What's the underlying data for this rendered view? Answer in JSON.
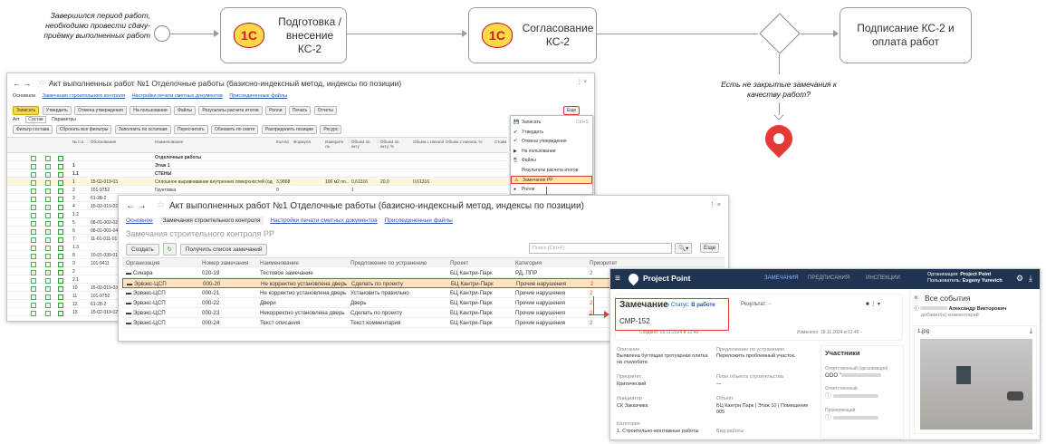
{
  "flow": {
    "start_note": "Завершился период работ, необходимо провести сдачу-приёмку выполненных работ",
    "logo_text": "1С",
    "stage1": "Подготовка / внесение КС-2",
    "stage2": "Согласование КС-2",
    "stage3": "Подписание КС-2 и оплата работ",
    "question": "Есть не закрытые замечания к качеству работ?"
  },
  "win1": {
    "title": "Акт выполненных работ №1 Отделочные работы (базисно-индексный метод, индексы по позиции)",
    "tabs": [
      "Основное",
      "Замечания строительного контроля",
      "Настройки печати сметных документов",
      "Присоединенные файлы"
    ],
    "toolbar": [
      "Записать",
      "Утвердить",
      "Отмена утверждения",
      "На пользовании",
      "Файлы",
      "Результаты расчета итогов",
      "Ролли",
      "Печать",
      "Отчеты"
    ],
    "more": "Еще",
    "subtabs": [
      "Акт",
      "Состав",
      "Параметры"
    ],
    "filters": [
      "Фильтр состава",
      "Сбросить все фильтры",
      "Заполнить по остаткам",
      "Пересчитать",
      "Обновить по смете",
      "Распределить позиции",
      "Ресурс"
    ],
    "columns": [
      "№ п.п.",
      "Обоснование",
      "Наименование",
      "Кол-во",
      "Формула",
      "Измерите ль",
      "Объем по акту",
      "Объем по акту, %",
      "Объем с начала",
      "Объем с начала, %",
      "Стоим"
    ],
    "rows": [
      {
        "n": "",
        "code": "",
        "name": "Отделочные работы",
        "q": "",
        "u": "",
        "a": "",
        "b": "",
        "c": ""
      },
      {
        "n": "1",
        "code": "",
        "name": "Этаж 1",
        "q": "",
        "u": "",
        "a": "",
        "b": "",
        "c": ""
      },
      {
        "n": "1.1",
        "code": "",
        "name": "СТЕНЫ",
        "q": "",
        "u": "",
        "a": "",
        "b": "",
        "c": ""
      },
      {
        "n": "1",
        "code": "15-02-019-03",
        "name": "Сплошное выравнивание внутренних поверхностей (одно...",
        "q": "3,9868",
        "u": "100 м2 по...",
        "a": "0,61316",
        "b": "20,0",
        "c": "0,61316"
      },
      {
        "n": "2",
        "code": "101-9752",
        "name": "Грунтовка",
        "q": "0",
        "u": "",
        "a": "1",
        "b": "",
        "c": ""
      },
      {
        "n": "3",
        "code": "61-28-2",
        "name": "Устройство основания под штукатурку из металлическ...",
        "q": "4,237",
        "u": "100 м2 по...",
        "a": "0,8474",
        "b": "20,0",
        "c": "0,8474"
      },
      {
        "n": "4",
        "code": "15-02-019-02",
        "name": "",
        "q": "",
        "u": "",
        "a": "",
        "b": "",
        "c": ""
      },
      {
        "n": "1.2",
        "code": "",
        "name": "",
        "q": "",
        "u": "",
        "a": "",
        "b": "",
        "c": ""
      },
      {
        "n": "5",
        "code": "08-01-002-02",
        "name": "",
        "q": "",
        "u": "",
        "a": "",
        "b": "",
        "c": ""
      },
      {
        "n": "6",
        "code": "08-01-001-04",
        "name": "",
        "q": "",
        "u": "",
        "a": "",
        "b": "",
        "c": ""
      },
      {
        "n": "7",
        "code": "11-01-011-01",
        "name": "",
        "q": "",
        "u": "",
        "a": "",
        "b": "",
        "c": ""
      },
      {
        "n": "1.3",
        "code": "",
        "name": "",
        "q": "",
        "u": "",
        "a": "",
        "b": "",
        "c": ""
      },
      {
        "n": "8",
        "code": "10-01-039-01",
        "name": "",
        "q": "",
        "u": "",
        "a": "",
        "b": "",
        "c": ""
      },
      {
        "n": "9",
        "code": "101-9411",
        "name": "",
        "q": "",
        "u": "",
        "a": "",
        "b": "",
        "c": ""
      },
      {
        "n": "2",
        "code": "",
        "name": "",
        "q": "",
        "u": "",
        "a": "",
        "b": "",
        "c": ""
      },
      {
        "n": "2.1",
        "code": "",
        "name": "",
        "q": "",
        "u": "",
        "a": "",
        "b": "",
        "c": ""
      },
      {
        "n": "10",
        "code": "15-02-019-03",
        "name": "",
        "q": "",
        "u": "",
        "a": "",
        "b": "",
        "c": ""
      },
      {
        "n": "11",
        "code": "101-9752",
        "name": "",
        "q": "",
        "u": "",
        "a": "",
        "b": "",
        "c": ""
      },
      {
        "n": "12",
        "code": "61-28-2",
        "name": "",
        "q": "",
        "u": "",
        "a": "",
        "b": "",
        "c": ""
      },
      {
        "n": "13",
        "code": "15-02-019-02",
        "name": "",
        "q": "",
        "u": "",
        "a": "",
        "b": "",
        "c": ""
      }
    ],
    "menu": [
      "Записать",
      "Утвердить",
      "Отмена утверждения",
      "На пользовании",
      "Файлы",
      "Результаты расчета итогов",
      "Замечания РР",
      "Ролли"
    ],
    "menu_shortcut": "Ctrl+S"
  },
  "win2": {
    "title": "Акт выполненных работ №1 Отделочные работы (базисно-индексный метод, индексы по позиции)",
    "tabs": [
      "Основное",
      "Замечания строительного контроля",
      "Настройки печати сметных документов",
      "Присоединенные файлы"
    ],
    "section": "Замечания строительного контроля РР",
    "create": "Создать",
    "getlist": "Получить список замечаний",
    "search": "Поиск (Ctrl+F)",
    "more": "Еще",
    "columns": [
      "Организация",
      "Номер замечания",
      "Наименование",
      "Предложение по устранению",
      "Проект",
      "Категория",
      "Приоритет"
    ],
    "rows": [
      {
        "org": "Синара",
        "num": "020-19",
        "name": "Тестовое замечание",
        "fix": "",
        "proj": "БЦ Кантри-Парк",
        "cat": "РД, ППР",
        "pri": "2"
      },
      {
        "org": "Эрвэкс-ЦСП",
        "num": "000-20",
        "name": "Не корректно установлена дверь",
        "fix": "Сделать по проекту",
        "proj": "БЦ Кантри-Парк",
        "cat": "Прочие нарушения",
        "pri": "2"
      },
      {
        "org": "Эрвэкс-ЦСП",
        "num": "000-21",
        "name": "Не корректно установлена дверь",
        "fix": "Установить правильно",
        "proj": "БЦ Кантри-Парк",
        "cat": "Прочие нарушения",
        "pri": "2"
      },
      {
        "org": "Эрвэкс-ЦСП",
        "num": "000-22",
        "name": "Двери",
        "fix": "Дверь",
        "proj": "БЦ Кантри-Парк",
        "cat": "Прочие нарушения",
        "pri": "2"
      },
      {
        "org": "Эрвэкс-ЦСП",
        "num": "000-23",
        "name": "Некорректно установлена дверь",
        "fix": "Сделать по проекту",
        "proj": "БЦ Кантри-Парк",
        "cat": "Прочие нарушения",
        "pri": "2"
      },
      {
        "org": "Эрвэкс-ЦСП",
        "num": "000-24",
        "name": "Текст описания",
        "fix": "Текст комментария",
        "proj": "БЦ Кантри-Парк",
        "cat": "Прочие нарушения",
        "pri": "2"
      }
    ]
  },
  "pp": {
    "brand": "Project Point",
    "nav": [
      "ЗАМЕЧАНИЯ",
      "ПРЕДПИСАНИЯ",
      "ИНСПЕКЦИИ"
    ],
    "org_label": "Организация:",
    "org": "Project Point",
    "user_label": "Пользователь:",
    "user": "Evgeny Yurevich",
    "heading": "Замечание",
    "status_label": "Статус:",
    "status": "В работе",
    "result": "Результат: -",
    "id": "СМР-152",
    "created": "Создано: 18.11.2024 в 12:45 -",
    "changed": "Изменено: 18.11.2024 в 12:46 -",
    "desc_label": "Описание",
    "desc": "Выявлена бугтящая тротуарная плитка на стилобате.",
    "fix_label": "Предложение по устранению",
    "fix": "Переложить проблемный участок.",
    "pri_label": "Приоритет",
    "pri": "Критический",
    "plan_label": "План объекта строительства",
    "plan": "—",
    "init_label": "Инициатор",
    "init": "СК Заказчика",
    "obj_label": "Объект",
    "obj": "БЦ Кантри Парк | Этаж 10 | Помещение 005",
    "cat_label": "Категория",
    "cat": "1. Строительно-монтажные работы",
    "type_label": "Вид работы",
    "participants": "Участники",
    "resp_org": "Ответственный (организация)",
    "resp_org_val": "ООО \"",
    "resp": "Ответственный",
    "checker": "Проверяющий",
    "events": "Все события",
    "event_user": "Александр Викторович",
    "event_text": "добавил(а) комментарий",
    "file": "1.jpg"
  },
  "colors": {
    "accent_red": "#e53935",
    "link": "#2856a8",
    "pp_header": "#1f3450",
    "yellow": "#ffd84a"
  }
}
